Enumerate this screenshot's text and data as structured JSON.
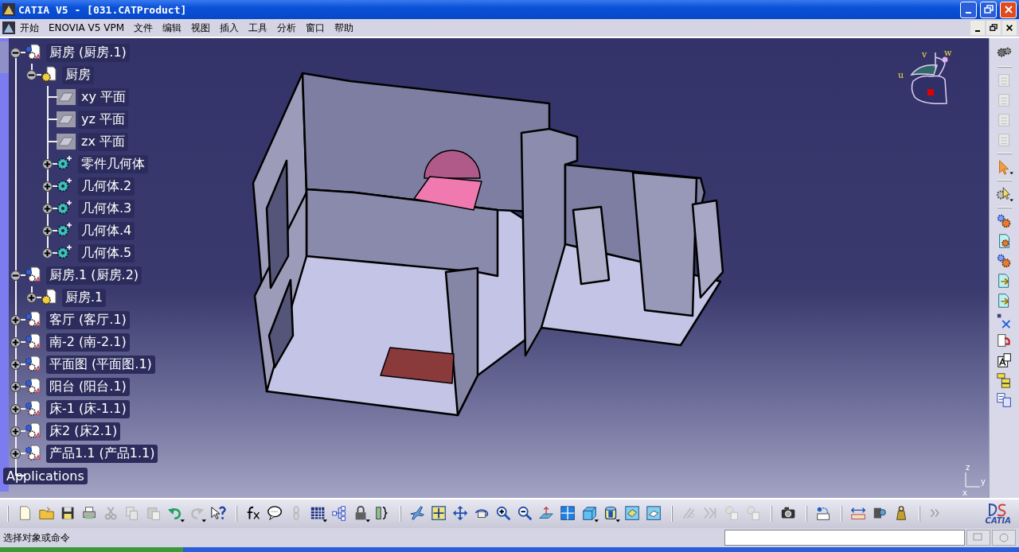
{
  "window": {
    "title": "CATIA V5 - [031.CATProduct]"
  },
  "menu": [
    {
      "label": "开始"
    },
    {
      "label": "ENOVIA V5 VPM"
    },
    {
      "label": "文件"
    },
    {
      "label": "编辑"
    },
    {
      "label": "视图"
    },
    {
      "label": "插入"
    },
    {
      "label": "工具"
    },
    {
      "label": "分析"
    },
    {
      "label": "窗口"
    },
    {
      "label": "帮助"
    }
  ],
  "tree": [
    {
      "label": "厨房 (厨房.1)",
      "kind": "product",
      "expanded": true,
      "children": [
        {
          "label": "厨房",
          "kind": "part",
          "expanded": true,
          "children": [
            {
              "label": "xy 平面",
              "kind": "plane"
            },
            {
              "label": "yz 平面",
              "kind": "plane"
            },
            {
              "label": "zx 平面",
              "kind": "plane"
            },
            {
              "label": "零件几何体",
              "kind": "body",
              "expanded": false
            },
            {
              "label": "几何体.2",
              "kind": "body",
              "expanded": false
            },
            {
              "label": "几何体.3",
              "kind": "body",
              "expanded": false
            },
            {
              "label": "几何体.4",
              "kind": "body",
              "expanded": false
            },
            {
              "label": "几何体.5",
              "kind": "body",
              "expanded": false
            }
          ]
        }
      ]
    },
    {
      "label": "厨房.1 (厨房.2)",
      "kind": "product",
      "expanded": true,
      "children": [
        {
          "label": "厨房.1",
          "kind": "part",
          "expanded": false
        }
      ]
    },
    {
      "label": "客厅 (客厅.1)",
      "kind": "product",
      "expanded": false
    },
    {
      "label": "南-2 (南-2.1)",
      "kind": "product",
      "expanded": false
    },
    {
      "label": "平面图 (平面图.1)",
      "kind": "product",
      "expanded": false
    },
    {
      "label": "阳台 (阳台.1)",
      "kind": "product",
      "expanded": false
    },
    {
      "label": "床-1 (床-1.1)",
      "kind": "product",
      "expanded": false
    },
    {
      "label": "床2 (床2.1)",
      "kind": "product",
      "expanded": false
    },
    {
      "label": "产品1.1 (产品1.1)",
      "kind": "product",
      "expanded": false
    },
    {
      "label": "Applications",
      "kind": "applications"
    }
  ],
  "compass": {
    "labels": [
      "u",
      "v",
      "w"
    ]
  },
  "axes": {
    "labels": [
      "z",
      "y",
      "x"
    ]
  },
  "logo": {
    "text": "CATIA"
  },
  "status_bar": {
    "prompt": "选择对象或命令"
  }
}
